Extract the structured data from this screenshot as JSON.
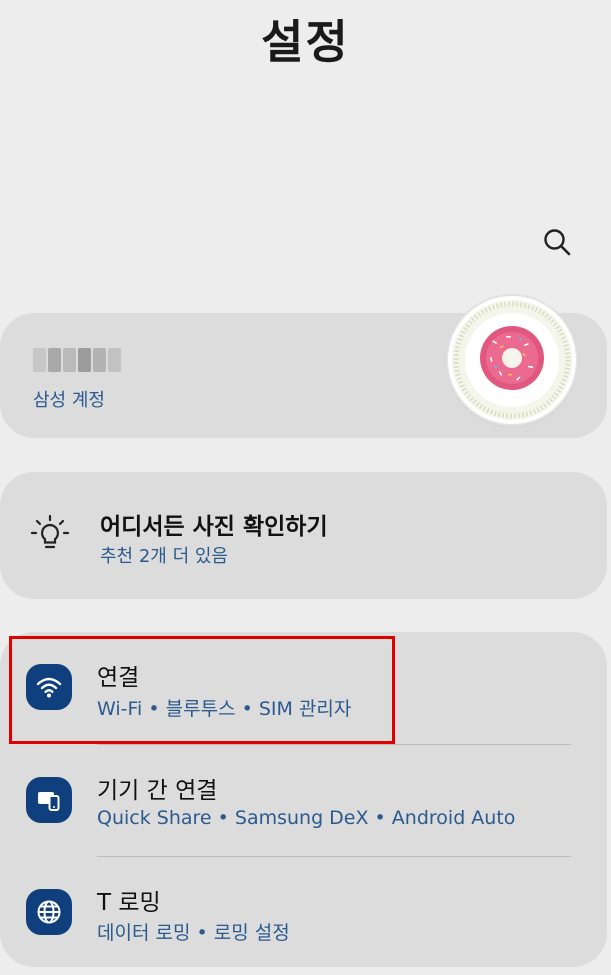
{
  "header": {
    "title": "설정"
  },
  "account": {
    "subtitle": "삼성 계정"
  },
  "suggestion": {
    "title": "어디서든 사진 확인하기",
    "subtitle": "추천 2개 더 있음"
  },
  "settings": [
    {
      "title": "연결",
      "subtitle": "Wi-Fi  •  블루투스  •  SIM 관리자",
      "icon": "wifi-icon"
    },
    {
      "title": "기기 간 연결",
      "subtitle": "Quick Share  •  Samsung DeX  •  Android Auto",
      "icon": "connected-devices-icon"
    },
    {
      "title": "T 로밍",
      "subtitle": "데이터 로밍  •  로밍 설정",
      "icon": "globe-icon"
    }
  ],
  "colors": {
    "background": "#ededed",
    "card": "#dcdcdc",
    "accent_text": "#2b5a8f",
    "icon_background": "#0f3f7c",
    "highlight": "#e00000"
  }
}
